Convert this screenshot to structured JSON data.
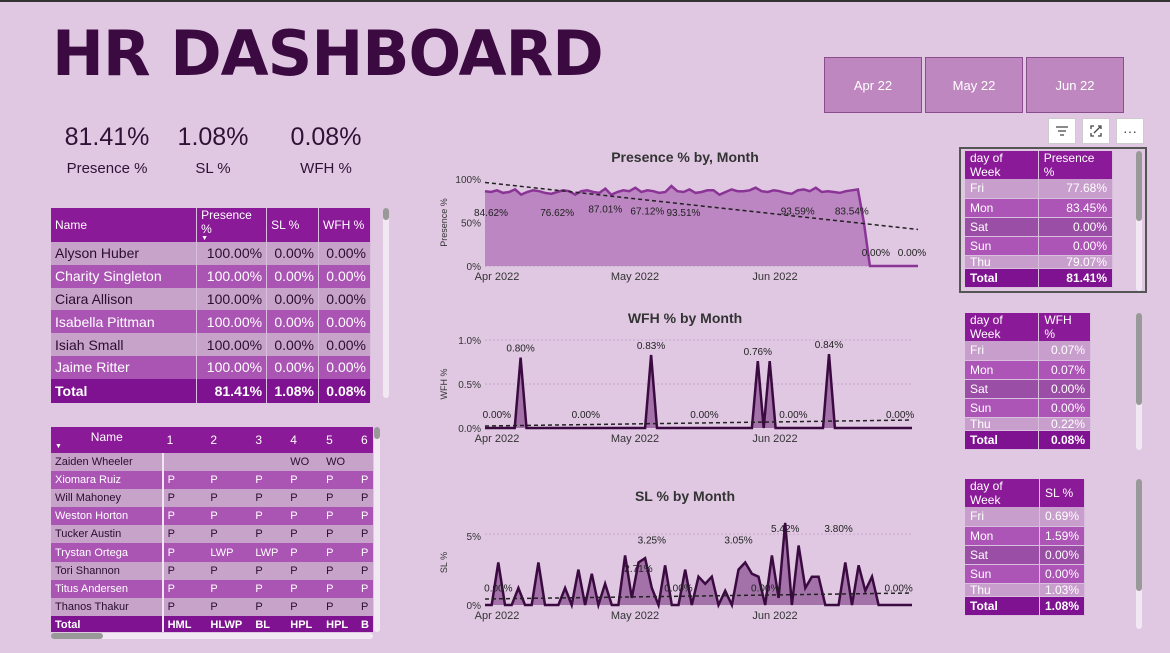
{
  "header": {
    "title": "HR DASHBOARD"
  },
  "months": [
    "Apr 22",
    "May 22",
    "Jun 22"
  ],
  "kpis": [
    {
      "value": "81.41%",
      "label": "Presence %"
    },
    {
      "value": "1.08%",
      "label": "SL %"
    },
    {
      "value": "0.08%",
      "label": "WFH %"
    }
  ],
  "emp_table": {
    "columns": [
      "Name",
      "Presence %",
      "SL %",
      "WFH %"
    ],
    "rows": [
      [
        "Alyson Huber",
        "100.00%",
        "0.00%",
        "0.00%"
      ],
      [
        "Charity Singleton",
        "100.00%",
        "0.00%",
        "0.00%"
      ],
      [
        "Ciara Allison",
        "100.00%",
        "0.00%",
        "0.00%"
      ],
      [
        "Isabella Pittman",
        "100.00%",
        "0.00%",
        "0.00%"
      ],
      [
        "Isiah Small",
        "100.00%",
        "0.00%",
        "0.00%"
      ],
      [
        "Jaime Ritter",
        "100.00%",
        "0.00%",
        "0.00%"
      ]
    ],
    "total": [
      "Total",
      "81.41%",
      "1.08%",
      "0.08%"
    ]
  },
  "att_table": {
    "columns": [
      "Name",
      "1",
      "2",
      "3",
      "4",
      "5",
      "6"
    ],
    "rows": [
      [
        "Zaiden Wheeler",
        "",
        "",
        "",
        "WO",
        "WO",
        ""
      ],
      [
        "Xiomara Ruiz",
        "P",
        "P",
        "P",
        "P",
        "P",
        "P"
      ],
      [
        "Will Mahoney",
        "P",
        "P",
        "P",
        "P",
        "P",
        "P"
      ],
      [
        "Weston Horton",
        "P",
        "P",
        "P",
        "P",
        "P",
        "P"
      ],
      [
        "Tucker Austin",
        "P",
        "P",
        "P",
        "P",
        "P",
        "P"
      ],
      [
        "Trystan Ortega",
        "P",
        "LWP",
        "LWP",
        "P",
        "P",
        "P"
      ],
      [
        "Tori Shannon",
        "P",
        "P",
        "P",
        "P",
        "P",
        "P"
      ],
      [
        "Titus Andersen",
        "P",
        "P",
        "P",
        "P",
        "P",
        "P"
      ],
      [
        "Thanos Thakur",
        "P",
        "P",
        "P",
        "P",
        "P",
        "P"
      ]
    ],
    "total": [
      "Total",
      "HML",
      "HLWP",
      "BL",
      "HPL",
      "HPL",
      "B"
    ]
  },
  "dow_presence": {
    "columns": [
      "day of Week",
      "Presence %"
    ],
    "rows": [
      [
        "Fri",
        "77.68%"
      ],
      [
        "Mon",
        "83.45%"
      ],
      [
        "Sat",
        "0.00%"
      ],
      [
        "Sun",
        "0.00%"
      ],
      [
        "Thu",
        "79.07%"
      ]
    ],
    "total": [
      "Total",
      "81.41%"
    ]
  },
  "dow_wfh": {
    "columns": [
      "day of Week",
      "WFH %"
    ],
    "rows": [
      [
        "Fri",
        "0.07%"
      ],
      [
        "Mon",
        "0.07%"
      ],
      [
        "Sat",
        "0.00%"
      ],
      [
        "Sun",
        "0.00%"
      ],
      [
        "Thu",
        "0.22%"
      ]
    ],
    "total": [
      "Total",
      "0.08%"
    ]
  },
  "dow_sl": {
    "columns": [
      "day of Week",
      "SL %"
    ],
    "rows": [
      [
        "Fri",
        "0.69%"
      ],
      [
        "Mon",
        "1.59%"
      ],
      [
        "Sat",
        "0.00%"
      ],
      [
        "Sun",
        "0.00%"
      ],
      [
        "Thu",
        "1.03%"
      ]
    ],
    "total": [
      "Total",
      "1.08%"
    ]
  },
  "colors": {
    "background": "#e0c8e3",
    "accent": "#8b1a98",
    "line": "#8a3596",
    "dark_line": "#3b0a40"
  },
  "icons": [
    "filter-icon",
    "focus-mode-icon",
    "more-options-icon"
  ],
  "chart_data": [
    {
      "type": "area",
      "title": "Presence % by, Month",
      "ylabel": "Presence %",
      "yticks": [
        "100%",
        "50%",
        "0%"
      ],
      "xticks": [
        "Apr 2022",
        "May 2022",
        "Jun 2022"
      ],
      "ylim": [
        0,
        1
      ],
      "values": [
        0.86,
        0.85,
        0.87,
        0.84,
        0.85,
        0.88,
        0.82,
        0.85,
        0.87,
        0.86,
        0.84,
        0.83,
        0.85,
        0.87,
        0.86,
        0.82,
        0.86,
        0.87,
        0.85,
        0.84,
        0.89,
        0.82,
        0.85,
        0.87,
        0.86,
        0.9,
        0.85,
        0.87,
        0.86,
        0.84,
        0.85,
        0.92,
        0.86,
        0.85,
        0.88,
        0.84,
        0.85,
        0.87,
        0.87,
        0.82,
        0.85,
        0.88,
        0.86,
        0.86,
        0.87,
        0.9,
        0.86,
        0.85,
        0.87,
        0.86,
        0.84,
        0.83,
        0.87,
        0.88,
        0.86,
        0.9,
        0.85,
        0.86,
        0.85,
        0.84,
        0.86,
        0.87,
        0.88,
        0.5,
        0.0,
        0.0,
        0.0,
        0.0,
        0.0,
        0.0,
        0.0,
        0.0,
        0.0
      ],
      "trend": [
        0.96,
        0.42
      ],
      "labels": [
        {
          "i": 1,
          "text": "84.62%"
        },
        {
          "i": 12,
          "text": "76.62%"
        },
        {
          "i": 20,
          "text": "87.01%"
        },
        {
          "i": 27,
          "text": "67.12%"
        },
        {
          "i": 33,
          "text": "93.51%"
        },
        {
          "i": 52,
          "text": "93.59%"
        },
        {
          "i": 61,
          "text": "83.54%"
        },
        {
          "i": 65,
          "text": "0.00%"
        },
        {
          "i": 71,
          "text": "0.00%"
        }
      ]
    },
    {
      "type": "line",
      "title": "WFH % by Month",
      "ylabel": "WFH %",
      "yticks": [
        "1.0%",
        "0.5%",
        "0.0%"
      ],
      "xticks": [
        "Apr 2022",
        "May 2022",
        "Jun 2022"
      ],
      "ylim": [
        0,
        0.01
      ],
      "spikes": [
        {
          "i": 6,
          "v": 0.008
        },
        {
          "i": 28,
          "v": 0.0083
        },
        {
          "i": 46,
          "v": 0.0076
        },
        {
          "i": 48,
          "v": 0.0076
        },
        {
          "i": 58,
          "v": 0.0084
        }
      ],
      "labels": [
        {
          "i": 6,
          "text": "0.80%",
          "v": 0.008
        },
        {
          "i": 2,
          "text": "0.00%",
          "v": 0
        },
        {
          "i": 17,
          "text": "0.00%",
          "v": 0
        },
        {
          "i": 28,
          "text": "0.83%",
          "v": 0.0083
        },
        {
          "i": 37,
          "text": "0.00%",
          "v": 0
        },
        {
          "i": 46,
          "text": "0.76%",
          "v": 0.0076
        },
        {
          "i": 52,
          "text": "0.00%",
          "v": 0
        },
        {
          "i": 58,
          "text": "0.84%",
          "v": 0.0084
        },
        {
          "i": 70,
          "text": "0.00%",
          "v": 0
        }
      ]
    },
    {
      "type": "line",
      "title": "SL % by Month",
      "ylabel": "SL %",
      "yticks": [
        "5%",
        "0%"
      ],
      "xticks": [
        "Apr 2022",
        "May 2022",
        "Jun 2022"
      ],
      "ylim": [
        0,
        0.06
      ],
      "values": [
        0,
        0,
        0.03,
        0,
        0,
        0.012,
        0,
        0,
        0.03,
        0,
        0,
        0,
        0.012,
        0,
        0.025,
        0,
        0.022,
        0,
        0.015,
        0,
        0,
        0.035,
        0.005,
        0.03,
        0.033,
        0.012,
        0,
        0.028,
        0,
        0,
        0.025,
        0,
        0.02,
        0.015,
        0.02,
        0,
        0.01,
        0,
        0.025,
        0.03,
        0.022,
        0.02,
        0,
        0.035,
        0.005,
        0.058,
        0,
        0.042,
        0.012,
        0.02,
        0.02,
        0,
        0,
        0,
        0.03,
        0,
        0.028,
        0.01,
        0.02,
        0,
        0,
        0,
        0,
        0,
        0
      ],
      "labels": [
        {
          "i": 2,
          "text": "0.00%",
          "v": 0.008
        },
        {
          "i": 23,
          "text": "2.71%",
          "v": 0.022
        },
        {
          "i": 25,
          "text": "3.25%",
          "v": 0.042
        },
        {
          "i": 29,
          "text": "0.00%",
          "v": 0.008
        },
        {
          "i": 38,
          "text": "3.05%",
          "v": 0.042
        },
        {
          "i": 42,
          "text": "0.00%",
          "v": 0.008
        },
        {
          "i": 45,
          "text": "5.42%",
          "v": 0.05
        },
        {
          "i": 53,
          "text": "3.80%",
          "v": 0.05
        },
        {
          "i": 62,
          "text": "0.00%",
          "v": 0.008
        }
      ]
    }
  ]
}
